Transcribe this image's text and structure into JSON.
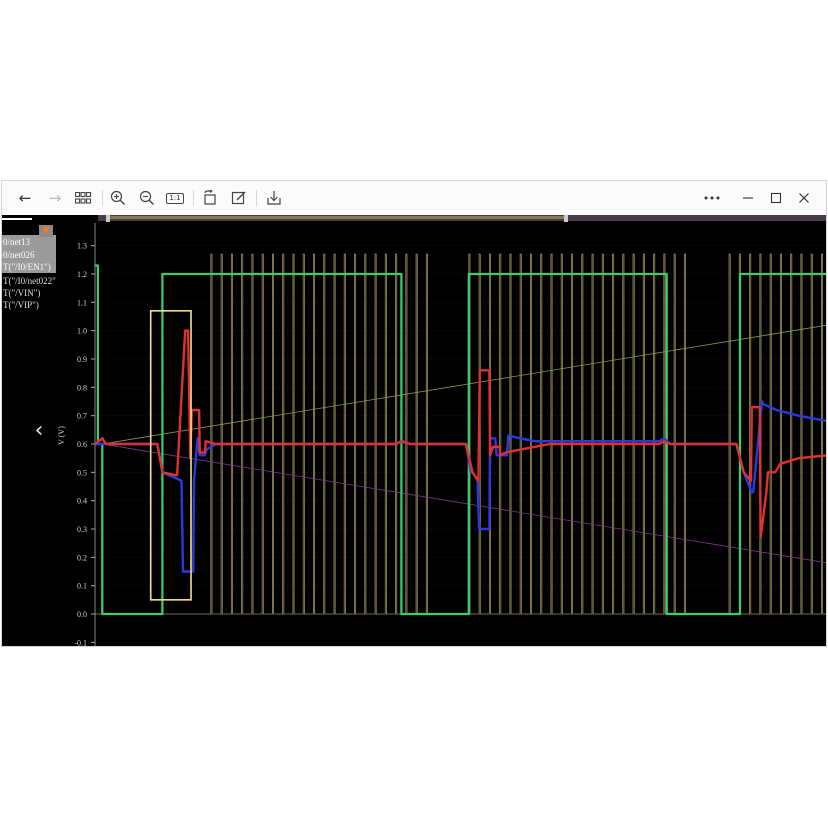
{
  "toolbar": {
    "back_icon": "arrow-left-icon",
    "forward_icon": "arrow-right-icon",
    "grid_icon": "grid-icon",
    "zoom_in_icon": "zoom-in-icon",
    "zoom_out_icon": "zoom-out-icon",
    "actual_size_label": "1:1",
    "rotate_icon": "rotate-icon",
    "edit_icon": "edit-icon",
    "save_icon": "save-icon",
    "more_icon": "more-icon",
    "minimize_icon": "minimize-icon",
    "maximize_icon": "maximize-icon",
    "close_icon": "close-icon"
  },
  "legend": {
    "items": [
      {
        "label": "0/net13",
        "selected": true
      },
      {
        "label": "0/net026",
        "selected": true
      },
      {
        "label": "T(\"/I0/EN1\")",
        "selected": true
      },
      {
        "label": "T(\"/I0/net022\"",
        "selected": false
      },
      {
        "label": "T(\"/VIN\")",
        "selected": false
      },
      {
        "label": "T(\"/VIP\")",
        "selected": false
      }
    ],
    "filter_icon": "filter-icon"
  },
  "nav": {
    "prev_icon": "chevron-left-icon"
  },
  "colors": {
    "background": "#000000",
    "clock": "#b8a870",
    "enable": "#3ccd6e",
    "vin": "#e03030",
    "vip": "#2a3ae0",
    "ramp_up": "#8a9a50",
    "ramp_down": "#7a3a8a",
    "highlight": "#f0e090"
  },
  "chart_data": {
    "type": "line",
    "ylabel": "V (V)",
    "yticks": [
      "-0.1",
      "0.0",
      "0.1",
      "0.2",
      "0.3",
      "0.4",
      "0.5",
      "0.6",
      "0.7",
      "0.8",
      "0.9",
      "1.0",
      "1.1",
      "1.2",
      "1.3"
    ],
    "ylim": [
      -0.12,
      1.38
    ],
    "xlim": [
      0,
      100
    ],
    "grid": true,
    "series": [
      {
        "key": "clock",
        "pulses": [
          15.8,
          17.2,
          18.6,
          20.0,
          21.4,
          22.8,
          24.2,
          25.6,
          27.0,
          28.4,
          29.8,
          31.2,
          32.6,
          34.0,
          35.4,
          36.8,
          38.2,
          39.6,
          41.0,
          42.4,
          43.8,
          45.2,
          51.0,
          52.4,
          53.8,
          55.2,
          56.6,
          58.0,
          59.4,
          60.8,
          62.2,
          63.6,
          65.0,
          66.4,
          67.8,
          69.2,
          70.6,
          72.0,
          73.4,
          74.8,
          76.2,
          77.6,
          79.0,
          80.4,
          86.5,
          87.9,
          89.3,
          90.7,
          92.1,
          93.5,
          94.9,
          96.3,
          97.7,
          99.1
        ],
        "low": 0.0,
        "high": 1.27
      },
      {
        "key": "enable",
        "x": [
          0,
          0.4,
          0.4,
          1.0,
          1.0,
          9.2,
          9.2,
          41.8,
          41.8,
          51.0,
          51.0,
          78.0,
          78.0,
          88.0,
          88.0,
          100
        ],
        "y": [
          1.23,
          1.23,
          0.6,
          0.6,
          0.0,
          0.0,
          1.2,
          1.2,
          0.0,
          0.0,
          1.2,
          1.2,
          0.0,
          0.0,
          1.2,
          1.2
        ]
      },
      {
        "key": "vin",
        "x": [
          0,
          0.5,
          1,
          1.5,
          8,
          8.5,
          9.2,
          11,
          11.2,
          12.3,
          12.4,
          12.7,
          13.0,
          13.2,
          14.2,
          14.3,
          15,
          15.1,
          16.5,
          17.5,
          21,
          41,
          41.8,
          43,
          50,
          50.6,
          51.5,
          52.3,
          52.5,
          53.8,
          53.9,
          54.3,
          55.2,
          55.3,
          56,
          58,
          60,
          62,
          66,
          77,
          77.6,
          78.5,
          87,
          87.5,
          88.5,
          89.5,
          89.6,
          90.7,
          90.8,
          91.6,
          91.8,
          92.8,
          93.5,
          96,
          100
        ],
        "y": [
          0.6,
          0.61,
          0.62,
          0.6,
          0.6,
          0.6,
          0.5,
          0.49,
          0.49,
          1.0,
          1.0,
          1.0,
          0.55,
          0.72,
          0.72,
          0.57,
          0.57,
          0.61,
          0.6,
          0.6,
          0.6,
          0.6,
          0.61,
          0.6,
          0.6,
          0.6,
          0.5,
          0.47,
          0.86,
          0.86,
          0.56,
          0.59,
          0.59,
          0.56,
          0.57,
          0.58,
          0.59,
          0.6,
          0.6,
          0.6,
          0.61,
          0.6,
          0.6,
          0.6,
          0.5,
          0.47,
          0.73,
          0.73,
          0.27,
          0.43,
          0.5,
          0.5,
          0.53,
          0.55,
          0.56
        ]
      },
      {
        "key": "vip",
        "x": [
          0,
          1.5,
          8,
          8.5,
          9.2,
          11,
          11.8,
          12.0,
          13.4,
          13.5,
          14.0,
          14.3,
          15.0,
          15.2,
          16.5,
          18,
          41,
          42,
          43,
          50,
          50.6,
          51.3,
          51.5,
          52.2,
          52.4,
          53.8,
          53.9,
          54.6,
          54.8,
          56.2,
          56.4,
          58,
          60,
          62,
          65,
          77,
          77.6,
          78.5,
          87,
          87.5,
          88.5,
          89.6,
          89.8,
          91,
          91.2,
          93,
          96,
          100
        ],
        "y": [
          0.6,
          0.6,
          0.6,
          0.6,
          0.5,
          0.48,
          0.47,
          0.15,
          0.15,
          0.47,
          0.62,
          0.56,
          0.56,
          0.58,
          0.6,
          0.6,
          0.6,
          0.61,
          0.6,
          0.6,
          0.6,
          0.5,
          0.5,
          0.47,
          0.3,
          0.3,
          0.62,
          0.62,
          0.56,
          0.56,
          0.63,
          0.62,
          0.61,
          0.61,
          0.61,
          0.61,
          0.62,
          0.6,
          0.6,
          0.6,
          0.5,
          0.43,
          0.43,
          0.75,
          0.74,
          0.72,
          0.7,
          0.68
        ]
      },
      {
        "key": "ramp_up",
        "x": [
          1,
          100
        ],
        "y": [
          0.6,
          1.02
        ]
      },
      {
        "key": "ramp_down",
        "x": [
          1,
          100
        ],
        "y": [
          0.6,
          0.18
        ]
      }
    ],
    "highlight_box": {
      "x0": 7.6,
      "x1": 13.1,
      "y0": 0.05,
      "y1": 1.07
    }
  }
}
